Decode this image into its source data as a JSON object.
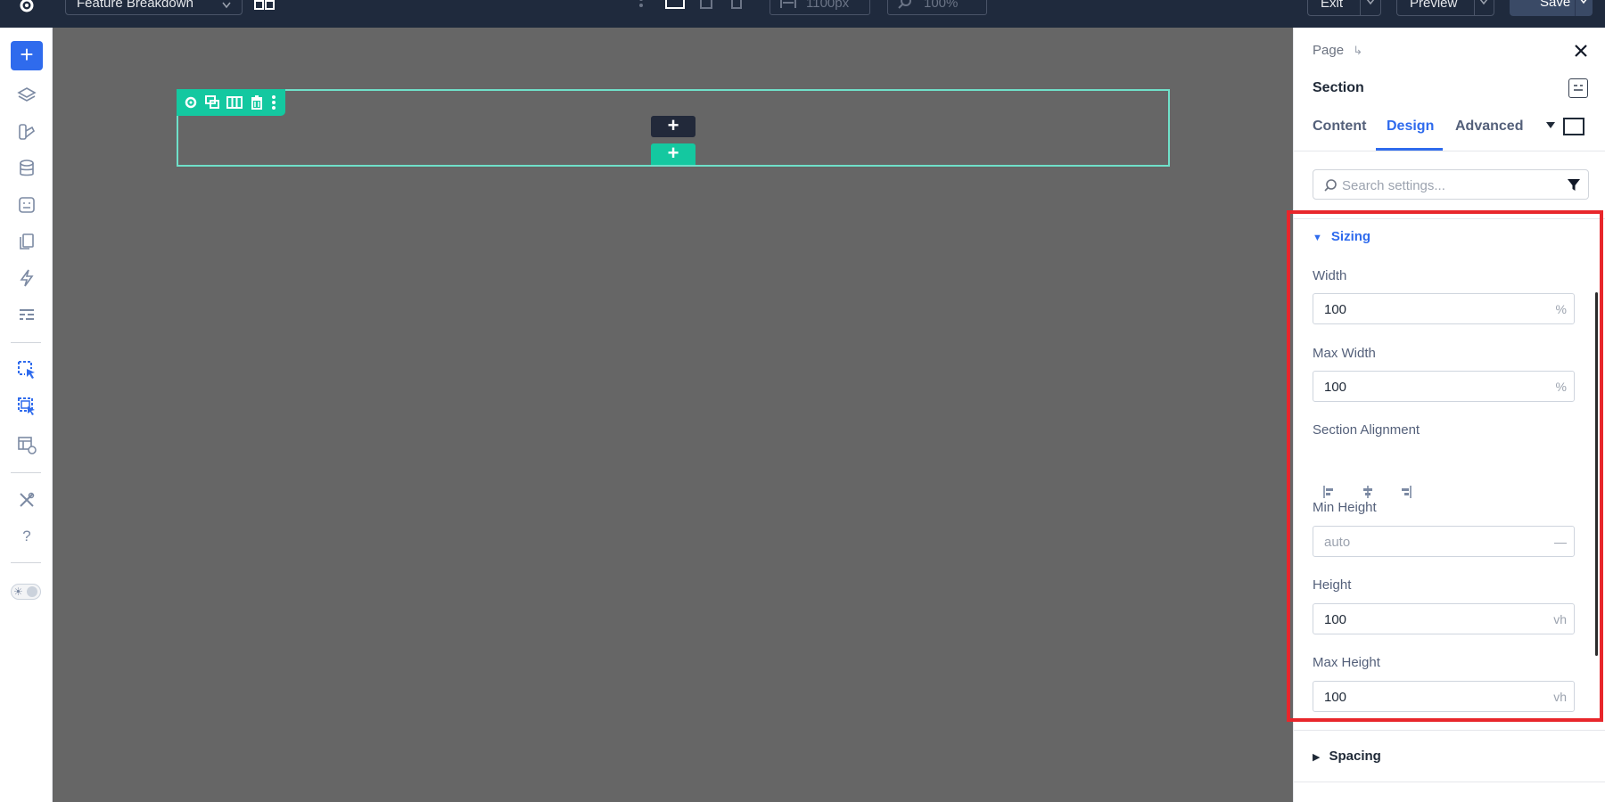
{
  "topbar": {
    "page_name": "Feature Breakdown",
    "width_value": "1100px",
    "zoom_value": "100%",
    "exit_label": "Exit",
    "preview_label": "Preview",
    "save_label": "Save"
  },
  "canvas": {
    "add_row_label": "+",
    "add_section_label": "+"
  },
  "panel": {
    "breadcrumb": "Page",
    "breadcrumb_arrow": "↳",
    "title": "Section",
    "tabs": [
      {
        "label": "Content"
      },
      {
        "label": "Design"
      },
      {
        "label": "Advanced"
      }
    ],
    "search_placeholder": "Search settings...",
    "sizing": {
      "heading": "Sizing",
      "width_label": "Width",
      "width_value": "100",
      "width_unit": "%",
      "max_width_label": "Max Width",
      "max_width_value": "100",
      "max_width_unit": "%",
      "alignment_label": "Section Alignment",
      "min_height_label": "Min Height",
      "min_height_placeholder": "auto",
      "min_height_unit": "—",
      "height_label": "Height",
      "height_value": "100",
      "height_unit": "vh",
      "max_height_label": "Max Height",
      "max_height_value": "100",
      "max_height_unit": "vh"
    },
    "spacing_heading": "Spacing"
  },
  "colors": {
    "accent": "#2f6bed",
    "teal": "#14c8a0",
    "highlight": "#e8262b",
    "topbar": "#1f2a3d"
  }
}
